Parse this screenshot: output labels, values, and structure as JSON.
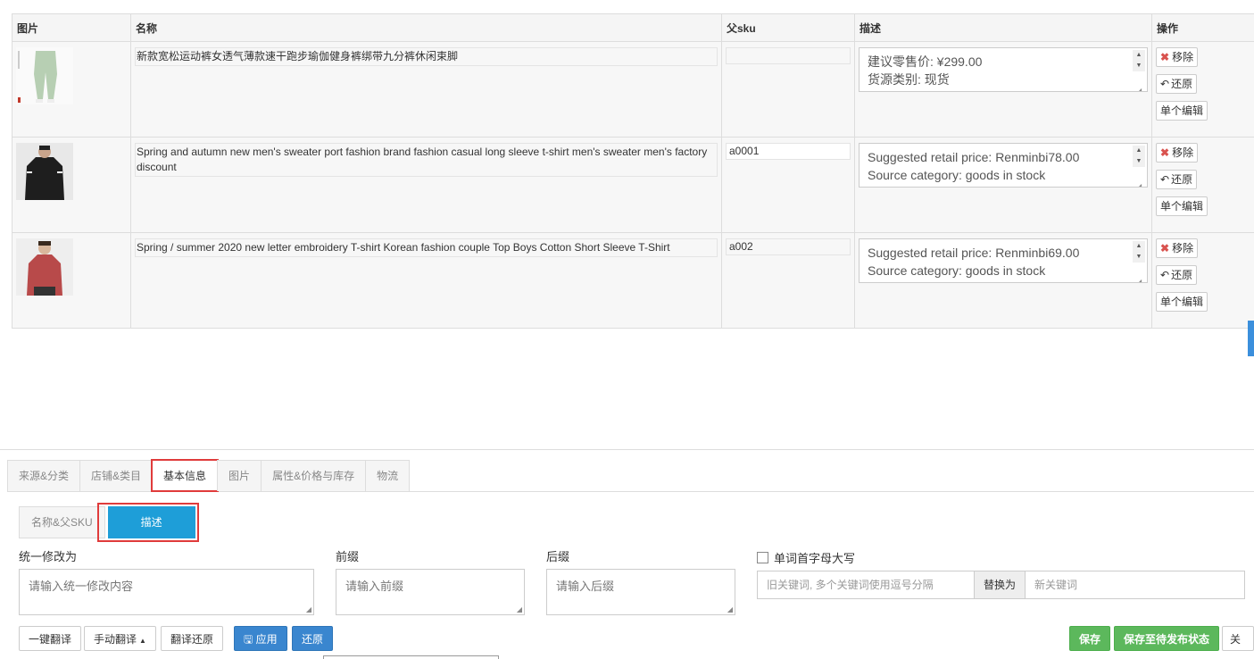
{
  "table": {
    "headers": {
      "image": "图片",
      "name": "名称",
      "sku": "父sku",
      "desc": "描述",
      "ops": "操作"
    },
    "rows": [
      {
        "name": "新款宽松运动裤女透气薄款速干跑步瑜伽健身裤绑带九分裤休闲束脚",
        "sku": "",
        "desc_line1": "建议零售价: ¥299.00",
        "desc_line2": "货源类别: 现货",
        "image_icon": "green-pants-photo"
      },
      {
        "name": "Spring and autumn new men's sweater port fashion brand fashion casual long sleeve t-shirt men's sweater men's factory discount",
        "sku": "a0001",
        "desc_line1": "Suggested retail price: Renminbi78.00",
        "desc_line2": "Source category: goods in stock",
        "image_icon": "black-sweater-photo"
      },
      {
        "name": "Spring / summer 2020 new letter embroidery T-shirt Korean fashion couple Top Boys Cotton Short Sleeve T-Shirt",
        "sku": "a002",
        "desc_line1": "Suggested retail price: Renminbi69.00",
        "desc_line2": "Source category: goods in stock",
        "image_icon": "red-tshirt-photo"
      }
    ],
    "ops": {
      "remove": "移除",
      "restore": "还原",
      "edit": "单个编辑"
    }
  },
  "tabs": [
    "来源&分类",
    "店铺&类目",
    "基本信息",
    "图片",
    "属性&价格与库存",
    "物流"
  ],
  "active_tab": "基本信息",
  "subtabs": [
    "名称&父SKU",
    "描述"
  ],
  "active_subtab": "描述",
  "form": {
    "unified_label": "统一修改为",
    "unified_placeholder": "请输入统一修改内容",
    "prefix_label": "前缀",
    "prefix_placeholder": "请输入前缀",
    "suffix_label": "后缀",
    "suffix_placeholder": "请输入后缀",
    "capitalize_label": "单词首字母大写",
    "old_kw_placeholder": "旧关键词, 多个关键词使用逗号分隔",
    "replace_label": "替换为",
    "new_kw_placeholder": "新关键词"
  },
  "actions": {
    "one_click_translate": "一键翻译",
    "manual_translate": "手动翻译",
    "translate_restore": "翻译还原",
    "apply": "应用",
    "restore": "还原",
    "save": "保存",
    "save_pending": "保存至待发布状态",
    "close": "关闭"
  },
  "colors": {
    "accent_blue": "#1e9ed8",
    "highlight_red": "#e03b3b",
    "save_green": "#5cb85c",
    "button_blue": "#3a86cf"
  }
}
